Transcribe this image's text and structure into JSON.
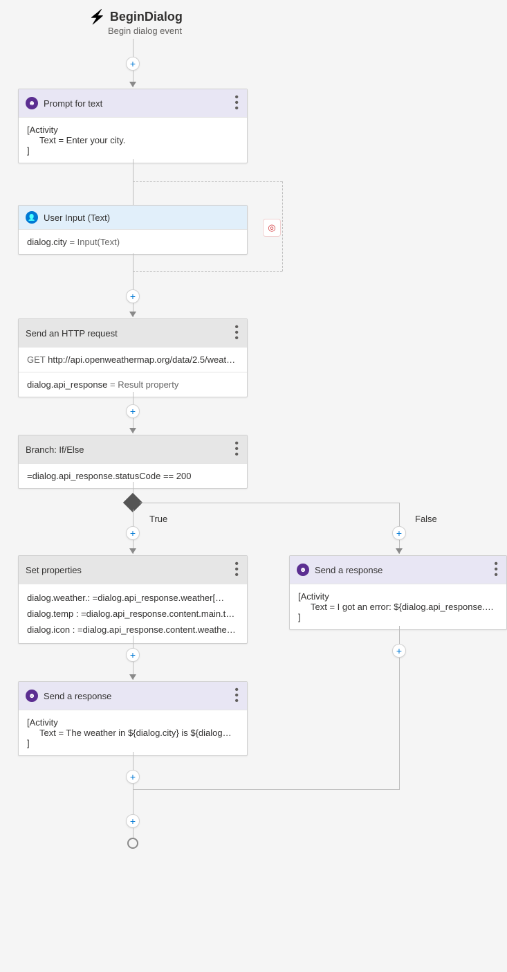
{
  "header": {
    "title": "BeginDialog",
    "subtitle": "Begin dialog event"
  },
  "prompt": {
    "title": "Prompt for text",
    "body_l1": "[Activity",
    "body_l2": "Text = Enter your city.",
    "body_l3": "]"
  },
  "userInput": {
    "title": "User Input (Text)",
    "assign_lhs": "dialog.city",
    "assign_rhs": "= Input(Text)"
  },
  "http": {
    "title": "Send an HTTP request",
    "method": "GET",
    "url": "http://api.openweathermap.org/data/2.5/weath…",
    "result_lhs": "dialog.api_response",
    "result_rhs": "= Result property"
  },
  "branch": {
    "title": "Branch: If/Else",
    "condition": "=dialog.api_response.statusCode == 200",
    "true_label": "True",
    "false_label": "False"
  },
  "setProps": {
    "title": "Set properties",
    "lines": [
      "dialog.weather.: =dialog.api_response.weather[…",
      "dialog.temp : =dialog.api_response.content.main.t…",
      "dialog.icon : =dialog.api_response.content.weathe…"
    ]
  },
  "respTrue": {
    "title": "Send a response",
    "body_l1": "[Activity",
    "body_l2": "Text = The weather in ${dialog.city} is ${dialog…",
    "body_l3": "]"
  },
  "respFalse": {
    "title": "Send a response",
    "body_l1": "[Activity",
    "body_l2": "Text = I got an error: ${dialog.api_response.conte…",
    "body_l3": "]"
  }
}
